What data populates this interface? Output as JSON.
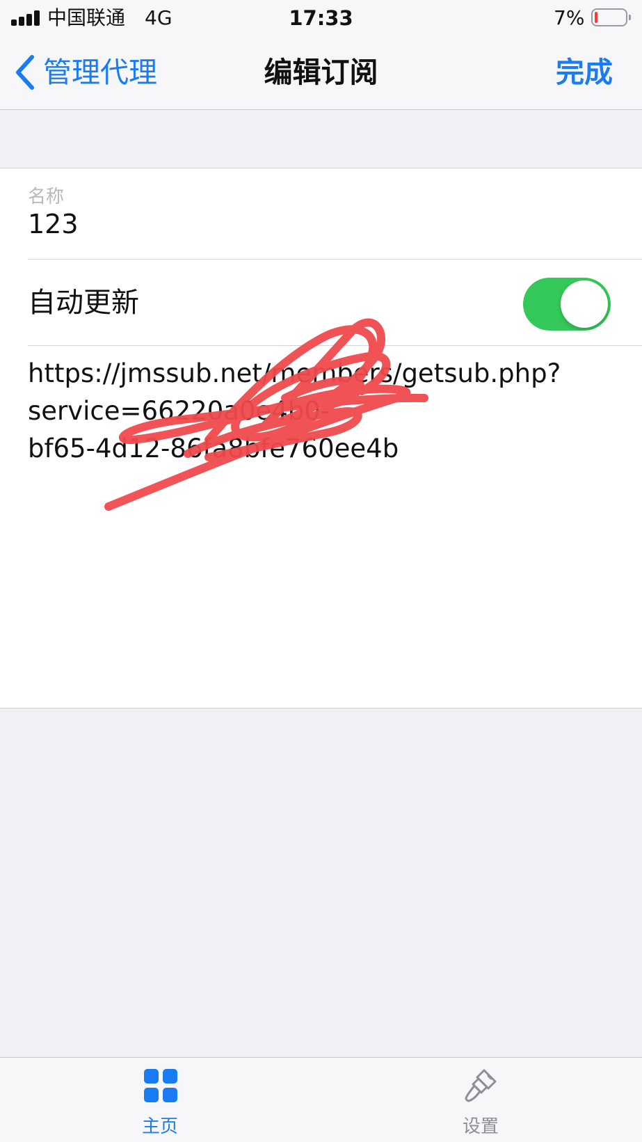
{
  "status_bar": {
    "carrier": "中国联通",
    "network": "4G",
    "time": "17:33",
    "battery_percent": "7%",
    "battery_level": 0.07,
    "signal_bars": 4,
    "icons": [
      "signal-bars-icon",
      "battery-icon"
    ]
  },
  "nav": {
    "back_label": "管理代理",
    "title": "编辑订阅",
    "done_label": "完成",
    "icons": [
      "chevron-left-icon"
    ]
  },
  "form": {
    "name_label": "名称",
    "name_value": "123",
    "auto_update_label": "自动更新",
    "auto_update_on": true,
    "url_text": "https://jmssub.net/members/getsub.php?\nservice=66220a0e4b0-\nbf65-4d12-86fa8bfe760ee4b"
  },
  "tabs": [
    {
      "label": "主页",
      "icon": "grid-icon",
      "active": true
    },
    {
      "label": "设置",
      "icon": "brush-icon",
      "active": false
    }
  ],
  "colors": {
    "accent": "#1a7cf2",
    "toggle_on": "#34c759",
    "scribble": "#f04a4e",
    "background": "#f0f0f5"
  }
}
